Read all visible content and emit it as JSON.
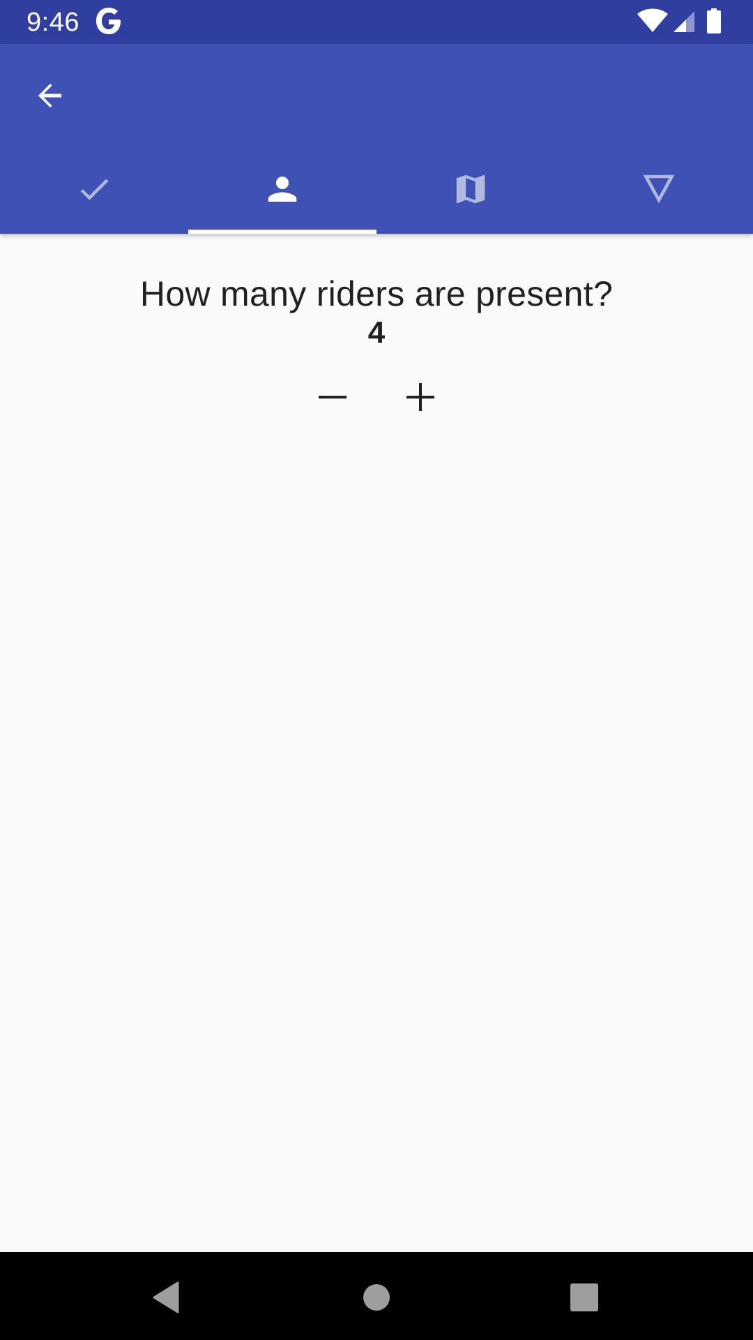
{
  "status_bar": {
    "time": "9:46",
    "icons": [
      "google-g-icon",
      "wifi-icon",
      "signal-icon",
      "battery-icon"
    ]
  },
  "app_bar": {
    "color": "#3f51b5",
    "status_color": "#303f9f",
    "back_icon": "arrow-back-icon",
    "tabs": [
      {
        "icon": "check-icon",
        "active": false
      },
      {
        "icon": "person-icon",
        "active": true
      },
      {
        "icon": "map-icon",
        "active": false
      },
      {
        "icon": "triangle-down-icon",
        "active": false
      }
    ]
  },
  "main": {
    "question": "How many riders are present?",
    "count": "4",
    "decrement_icon": "minus-icon",
    "increment_icon": "plus-icon"
  },
  "nav_bar": {
    "buttons": [
      "nav-back-icon",
      "nav-home-icon",
      "nav-recents-icon"
    ]
  }
}
